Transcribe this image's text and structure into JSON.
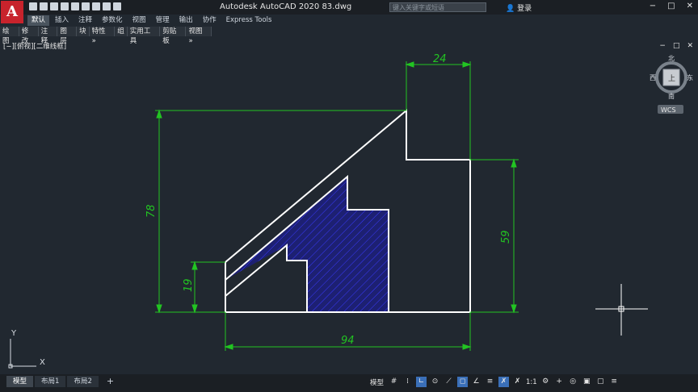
{
  "app": {
    "logo_letter": "A",
    "title": "Autodesk AutoCAD 2020    83.dwg"
  },
  "search": {
    "placeholder": "键入关键字或短语"
  },
  "user": {
    "login_label": "登录"
  },
  "window_buttons": [
    "−",
    "□",
    "✕"
  ],
  "ribbon_tabs": [
    "默认",
    "插入",
    "注释",
    "参数化",
    "视图",
    "管理",
    "输出",
    "协作",
    "Express Tools"
  ],
  "active_tab": 0,
  "toolbar_items": [
    "绘图",
    "修改",
    "注释",
    "图层",
    "块",
    "特性 »",
    "组",
    "实用工具",
    "剪贴板",
    "视图 »"
  ],
  "viewport": {
    "label": "[−][俯视][二维线框]",
    "buttons": [
      "−",
      "□",
      "✕"
    ]
  },
  "viewcube": {
    "north": "北",
    "south": "南",
    "east": "东",
    "west": "西",
    "face": "上",
    "wcs": "WCS"
  },
  "ucs": {
    "x": "X",
    "y": "Y"
  },
  "dimensions": {
    "top": "24",
    "left": "78",
    "left_small": "19",
    "right": "59",
    "bottom": "94"
  },
  "layout_tabs": [
    "模型",
    "布局1",
    "布局2",
    "+"
  ],
  "status": {
    "model_label": "模型",
    "scale": "1:1"
  },
  "colors": {
    "background": "#212830",
    "geometry": "#ffffff",
    "dimension": "#22c422",
    "hatch": "#1a1aa8"
  }
}
